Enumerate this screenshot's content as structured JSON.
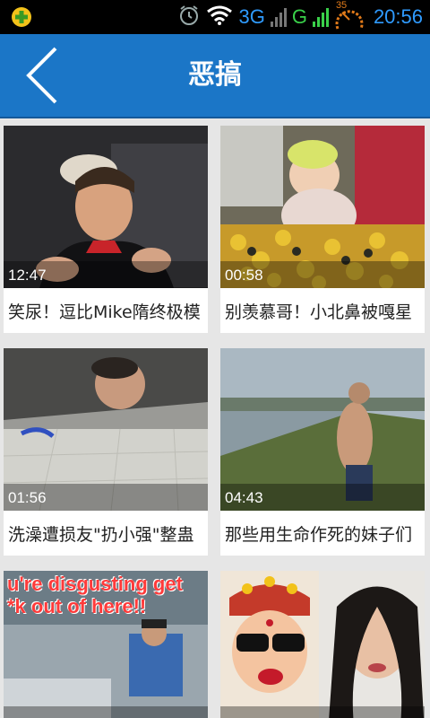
{
  "status_bar": {
    "network_3g": "3G",
    "network_g": "G",
    "battery": "35",
    "time": "20:56"
  },
  "header": {
    "title": "恶搞",
    "color": "#1b76c7"
  },
  "videos": [
    {
      "duration": "12:47",
      "title": "笑尿！逗比Mike隋终极模"
    },
    {
      "duration": "00:58",
      "title": "别羡慕哥！小北鼻被嘎星"
    },
    {
      "duration": "01:56",
      "title": "洗澡遭损友\"扔小强\"整蛊"
    },
    {
      "duration": "04:43",
      "title": "那些用生命作死的妹子们"
    },
    {
      "duration": "",
      "title": "",
      "overlay": "u're disgusting get\n*k out of here!!"
    },
    {
      "duration": "",
      "title": ""
    }
  ]
}
